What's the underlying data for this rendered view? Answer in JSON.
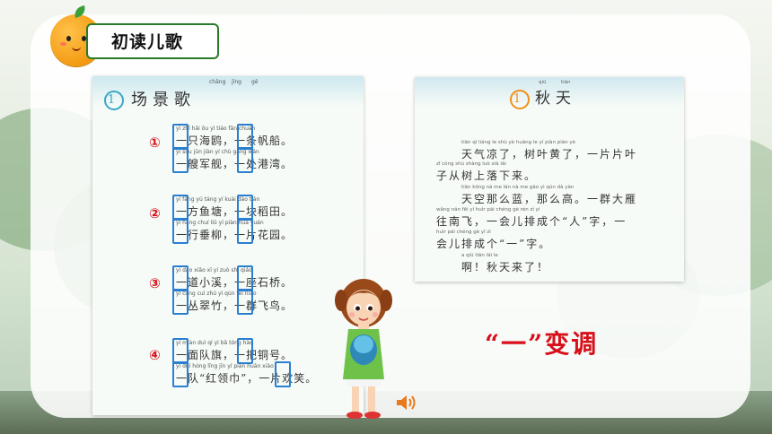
{
  "header": {
    "title": "初读儿歌",
    "mascot_icon": "orange-mascot-icon"
  },
  "left_page": {
    "lesson_number": "1",
    "title": "场景歌",
    "title_pinyin": [
      "chǎng",
      "jǐng",
      "gē"
    ],
    "markers": [
      "①",
      "②",
      "③",
      "④"
    ],
    "lines": [
      {
        "pinyin": "yì  zhī hǎi ōu     yì  tiáo fān chuán",
        "text": "一只海鸥，一条帆船。"
      },
      {
        "pinyin": "yì  sōu jūn jiàn    yí  chù gǎng wān",
        "text": "一艘军舰，一处港湾。"
      },
      {
        "pinyin": "yí  fāng yú táng    yí  kuài dào tián",
        "text": "一方鱼塘，一块稻田。"
      },
      {
        "pinyin": "yì  háng chuí liǔ    yí  piàn huā yuán",
        "text": "一行垂柳，一片花园。"
      },
      {
        "pinyin": "yí  dào xiǎo xī     yí  zuò shí qiáo",
        "text": "一道小溪，一座石桥。"
      },
      {
        "pinyin": "yì  cóng cuì zhú    yì  qún fēi niǎo",
        "text": "一丛翠竹，一群飞鸟。"
      },
      {
        "pinyin": "yí  miàn duì qí     yì  bǎ tóng hào",
        "text": "一面队旗，一把铜号。"
      },
      {
        "pinyin": "yí  duì   hóng lǐng jīn    yí piàn huān xiào",
        "text": "一队“红领巾”，一片欢笑。"
      }
    ],
    "box_pinyin": "yì"
  },
  "right_page": {
    "lesson_number": "1",
    "title": "秋天",
    "title_pinyin": [
      "qiū",
      "tiān"
    ],
    "lines": [
      {
        "pinyin": "tiān  qì  liáng le       shù  yè huáng le      yí  piàn piàn yè",
        "text": "天气凉了，树叶黄了，一片片叶"
      },
      {
        "pinyin": "zǐ  cóng shù shàng luò xià lái",
        "text": "子从树上落下来。"
      },
      {
        "pinyin": "tiān kōng nà  me  lán    nà  me gāo    yì  qún dà  yàn",
        "text": "天空那么蓝，那么高。一群大雁"
      },
      {
        "pinyin": "wǎng nán fēi   yí huìr pái chéng gè      rén      zì     yí",
        "text": "往南飞，一会儿排成个“人”字，一"
      },
      {
        "pinyin": "huìr pái chéng gè      yī       zì",
        "text": "会儿排成个“一”字。"
      },
      {
        "pinyin": "a      qiū tiān lái le",
        "text": "啊！秋天来了！"
      }
    ]
  },
  "topic_label": "“一”变调",
  "speaker_icon": "speaker-icon"
}
